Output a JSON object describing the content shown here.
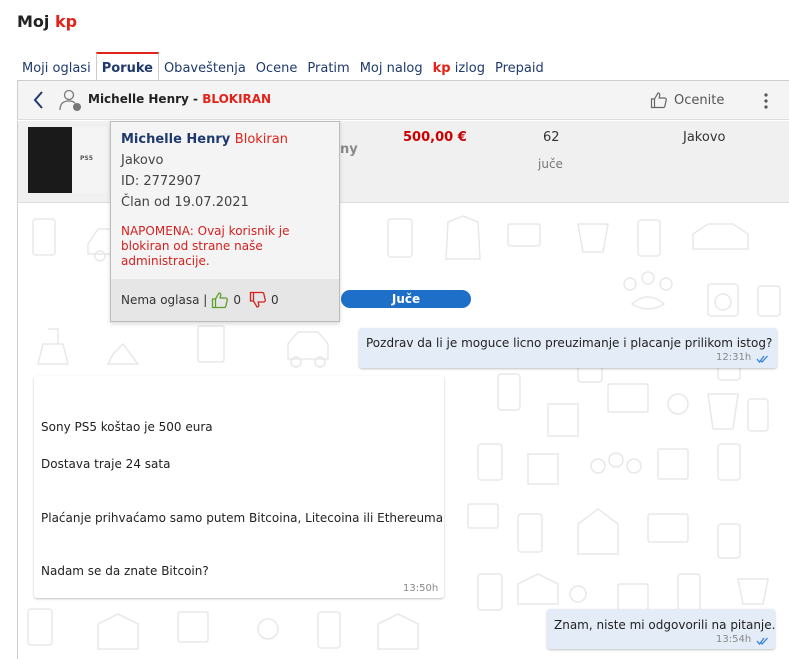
{
  "page": {
    "title_prefix": "Moj ",
    "title_brand": "kp"
  },
  "tabs": [
    {
      "label": "Moji oglasi"
    },
    {
      "label": "Poruke",
      "active": true
    },
    {
      "label": "Obaveštenja"
    },
    {
      "label": "Ocene"
    },
    {
      "label": "Pratim"
    },
    {
      "label": "Moj nalog"
    },
    {
      "brand": "kp",
      "label": " izlog"
    },
    {
      "label": "Prepaid"
    }
  ],
  "header": {
    "name": "Michelle Henry - ",
    "status": "BLOKIRAN",
    "rate_label": "Ocenite"
  },
  "ad": {
    "thumb_text": "PS5",
    "title_partial": "ny",
    "price": "500,00 €",
    "views": "62",
    "date": "juče",
    "location": "Jakovo"
  },
  "popup": {
    "name": "Michelle Henry",
    "status": "Blokiran",
    "location": "Jakovo",
    "id": "ID: 2772907",
    "member_since": "Član od 19.07.2021",
    "note": "NAPOMENA: Ovaj korisnik je blokiran od strane naše administracije.",
    "no_ads": "Nema oglasa |",
    "likes": "0",
    "dislikes": "0"
  },
  "chat": {
    "date_divider": "Juče",
    "messages": [
      {
        "direction": "out",
        "text": "Pozdrav da li je moguce licno preuzimanje i placanje prilikom istog?",
        "time": "12:31h"
      },
      {
        "direction": "in",
        "lines": [
          "Sony PS5 koštao je 500 eura",
          "Dostava traje 24 sata",
          "Plaćanje prihvaćamo samo putem Bitcoina, Litecoina ili Ethereuma",
          "Nadam se da znate Bitcoin?"
        ],
        "time": "13:50h"
      },
      {
        "direction": "out",
        "text": "Znam, niste mi odgovorili na pitanje.",
        "time": "13:54h"
      }
    ]
  },
  "colors": {
    "brand_red": "#e2231a",
    "link_blue": "#1f3a6d",
    "pill_blue": "#1e6fc8",
    "out_bubble": "#e4edf7",
    "tick_blue": "#2b7bd8"
  }
}
